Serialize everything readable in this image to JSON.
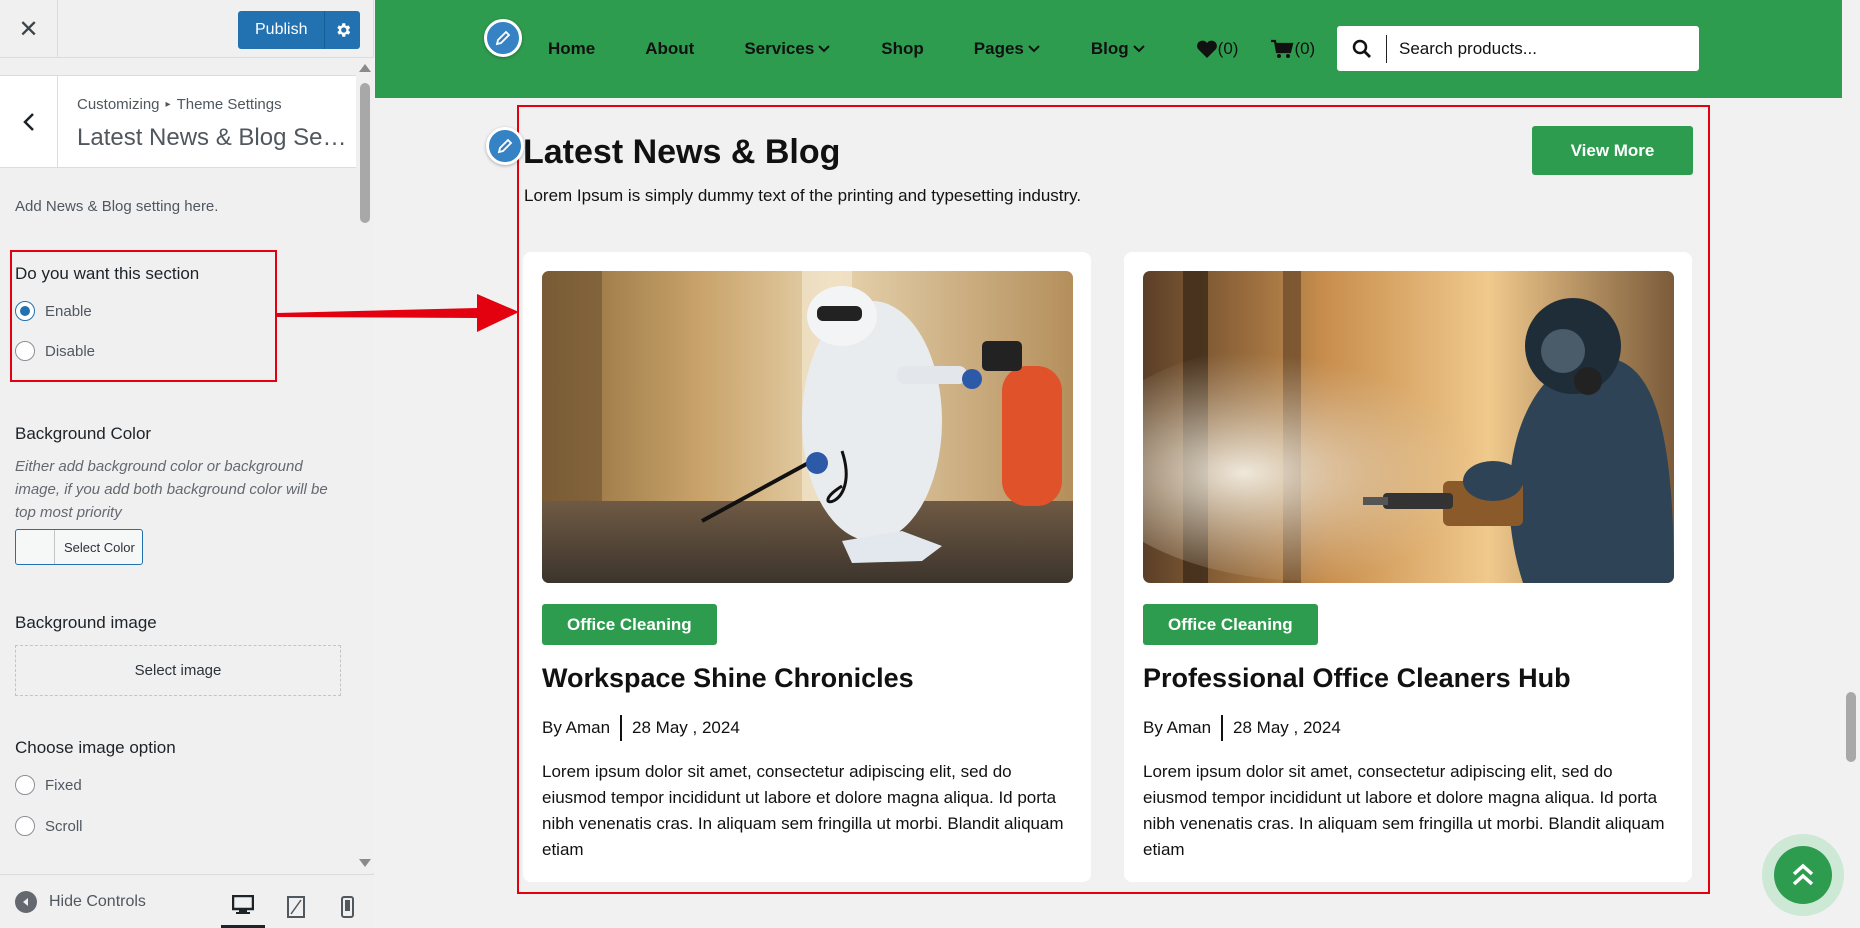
{
  "customizer": {
    "publish_label": "Publish",
    "breadcrumb": {
      "root": "Customizing",
      "section": "Theme Settings"
    },
    "panel_title": "Latest News & Blog Sec...",
    "description": "Add News & Blog setting here.",
    "section_toggle": {
      "label": "Do you want this section",
      "options": [
        "Enable",
        "Disable"
      ],
      "selected": "Enable"
    },
    "background_color": {
      "label": "Background Color",
      "hint": "Either add background color or background image, if you add both background color will be top most priority",
      "button_label": "Select Color"
    },
    "background_image": {
      "label": "Background image",
      "button_label": "Select image"
    },
    "image_option": {
      "label": "Choose image option",
      "options": [
        "Fixed",
        "Scroll"
      ]
    },
    "footer": {
      "hide_controls": "Hide Controls"
    },
    "colors": {
      "publish": "#2271b1",
      "highlight": "#e3000f"
    }
  },
  "site": {
    "nav": {
      "items": [
        "Home",
        "About",
        "Services",
        "Shop",
        "Pages",
        "Blog"
      ],
      "wishlist_count": "(0)",
      "cart_count": "(0)",
      "search_placeholder": "Search products..."
    },
    "section": {
      "title": "Latest News & Blog",
      "subtitle": "Lorem Ipsum is simply dummy text of the printing and typesetting industry.",
      "view_more": "View More"
    },
    "posts": [
      {
        "category": "Office Cleaning",
        "title": "Workspace Shine Chronicles",
        "author": "By Aman",
        "date": "28 May , 2024",
        "excerpt": "Lorem ipsum dolor sit amet, consectetur adipiscing elit, sed do eiusmod tempor incididunt ut labore et dolore magna aliqua. Id porta nibh venenatis cras. In aliquam sem fringilla ut morbi. Blandit aliquam etiam"
      },
      {
        "category": "Office Cleaning",
        "title": "Professional Office Cleaners Hub",
        "author": "By Aman",
        "date": "28 May , 2024",
        "excerpt": "Lorem ipsum dolor sit amet, consectetur adipiscing elit, sed do eiusmod tempor incididunt ut labore et dolore magna aliqua. Id porta nibh venenatis cras. In aliquam sem fringilla ut morbi. Blandit aliquam etiam"
      }
    ],
    "colors": {
      "brand_green": "#2e9c4f"
    }
  }
}
